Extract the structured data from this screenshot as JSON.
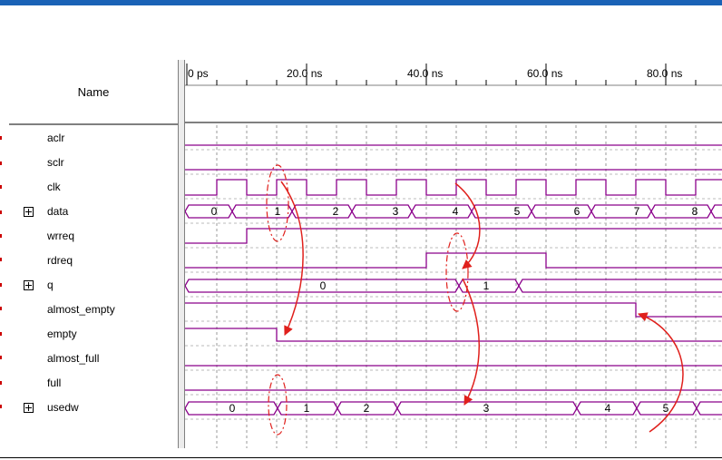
{
  "header": {
    "name_label": "Name"
  },
  "signals": [
    {
      "name": "aclr",
      "group": false
    },
    {
      "name": "sclr",
      "group": false
    },
    {
      "name": "clk",
      "group": false
    },
    {
      "name": "data",
      "group": true
    },
    {
      "name": "wrreq",
      "group": false
    },
    {
      "name": "rdreq",
      "group": false
    },
    {
      "name": "q",
      "group": true
    },
    {
      "name": "almost_empty",
      "group": false
    },
    {
      "name": "empty",
      "group": false
    },
    {
      "name": "almost_full",
      "group": false
    },
    {
      "name": "full",
      "group": false
    },
    {
      "name": "usedw",
      "group": true
    }
  ],
  "time_labels": [
    "0 ps",
    "20.0 ns",
    "40.0 ns",
    "60.0 ns",
    "80.0 ns"
  ],
  "bus_values": {
    "data": [
      "0",
      "1",
      "2",
      "3",
      "4",
      "5",
      "6",
      "7",
      "8"
    ],
    "q": [
      "0",
      "1"
    ],
    "usedw": [
      "0",
      "1",
      "2",
      "3",
      "4",
      "5"
    ]
  },
  "colors": {
    "accent": "#1a62b6",
    "signal": "#8b008b",
    "arrow": "#e0201c"
  }
}
